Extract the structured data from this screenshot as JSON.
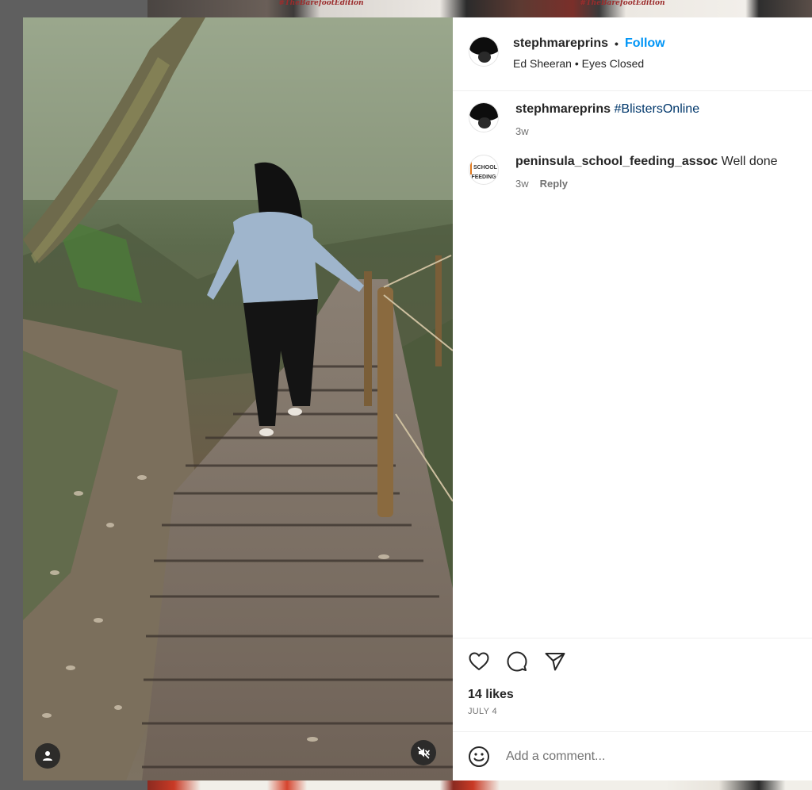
{
  "background": {
    "top_tags": [
      "#TheBarefootEdition",
      "#TheBarefootEdition"
    ]
  },
  "post": {
    "author": {
      "username": "stephmareprins",
      "follow_label": "Follow",
      "separator": "•"
    },
    "audio": {
      "artist": "Ed Sheeran",
      "separator": "•",
      "track": "Eyes Closed",
      "label": "Ed Sheeran • Eyes Closed"
    },
    "caption": {
      "username": "stephmareprins",
      "hashtag": "#BlistersOnline",
      "time": "3w"
    },
    "comments": [
      {
        "username": "peninsula_school_feeding_assoc",
        "text": "Well done",
        "time": "3w",
        "reply_label": "Reply",
        "avatar_text": "SCHOOL FEEDING"
      }
    ],
    "likes": "14 likes",
    "date": "JULY 4",
    "add_comment_placeholder": "Add a comment..."
  },
  "icons": {
    "like": "heart-icon",
    "comment": "comment-icon",
    "share": "share-icon",
    "emoji": "emoji-icon",
    "user_tag": "user-tag-icon",
    "mute": "muted-speaker-icon"
  },
  "colors": {
    "accent": "#0095f6",
    "hashtag": "#00376b",
    "text": "#262626",
    "muted": "#737373",
    "overlay": "#5f5f5f"
  }
}
